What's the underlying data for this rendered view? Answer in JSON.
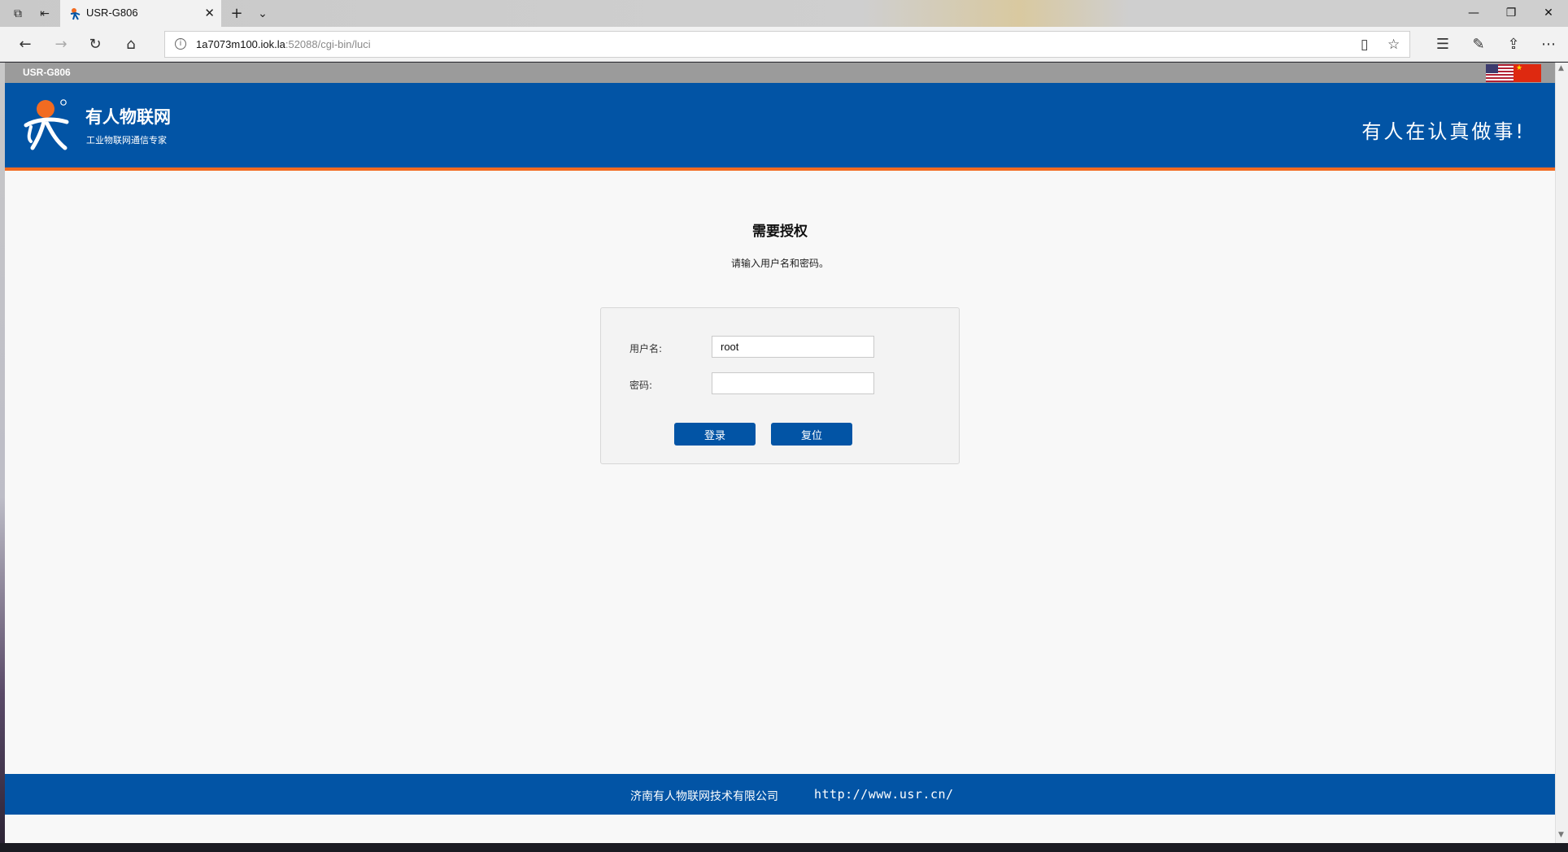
{
  "browser": {
    "tab_title": "USR-G806",
    "address_host": "1a7073m100.iok.la",
    "address_rest": ":52088/cgi-bin/luci",
    "icons": {
      "tab_actions": "tab-actions-icon",
      "set_aside": "set-aside-tabs-icon",
      "new_tab": "plus-icon",
      "tab_list": "chevron-down-icon",
      "back": "back-arrow-icon",
      "forward": "forward-arrow-icon",
      "refresh": "refresh-icon",
      "home": "home-icon",
      "reading_view": "book-icon",
      "favorite": "star-icon",
      "favorites_hub": "favorites-list-icon",
      "notes": "pen-icon",
      "share": "share-icon",
      "more": "more-icon"
    }
  },
  "page": {
    "top_bar_title": "USR-G806",
    "brand_name": "有人物联网",
    "brand_sub": "工业物联网通信专家",
    "slogan": "有人在认真做事!",
    "login": {
      "title": "需要授权",
      "subtitle": "请输入用户名和密码。",
      "username_label": "用户名:",
      "username_value": "root",
      "password_label": "密码:",
      "password_value": "",
      "login_button": "登录",
      "reset_button": "复位"
    },
    "footer": {
      "company": "济南有人物联网技术有限公司",
      "url": "http://www.usr.cn/"
    }
  },
  "colors": {
    "brand_blue": "#0254a5",
    "accent_orange": "#f26b21"
  }
}
